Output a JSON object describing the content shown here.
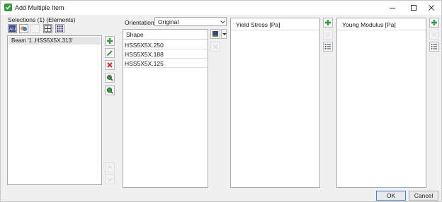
{
  "window": {
    "title": "Add Multiple Item",
    "controls": [
      "minimize-icon",
      "maximize-icon",
      "close-icon"
    ]
  },
  "selections": {
    "label": "Selections (1) (Elements)",
    "toolbar_icons": [
      "select-all-icon",
      "select-filter-icon",
      "select-blank-icon",
      "grid-icon",
      "grid-dark-icon"
    ],
    "items": [
      "Beam '1..HSS5X5X.313'"
    ],
    "side_icons": [
      "add-green-icon",
      "edit-icon",
      "delete-red-icon",
      "zoom-icon",
      "zoom-green-icon"
    ],
    "disabled_icons": [
      "move-up-icon",
      "move-down-icon"
    ]
  },
  "orientation": {
    "label": "Orientation",
    "value": "Original"
  },
  "shape_table": {
    "header": "Shape",
    "rows": [
      "HSS5X5X.250",
      "HSS5X5X.188",
      "HSS5X5X.125"
    ]
  },
  "yield_table": {
    "header": "Yield Stress [Pa]",
    "rows": []
  },
  "young_table": {
    "header": "Young Modulus [Pa]",
    "rows": []
  },
  "colors": {
    "green": "#2e9e3a",
    "red": "#d42a2a",
    "primary_border": "#3c7fd1"
  },
  "buttons": {
    "ok": "OK",
    "cancel": "Cancel"
  }
}
